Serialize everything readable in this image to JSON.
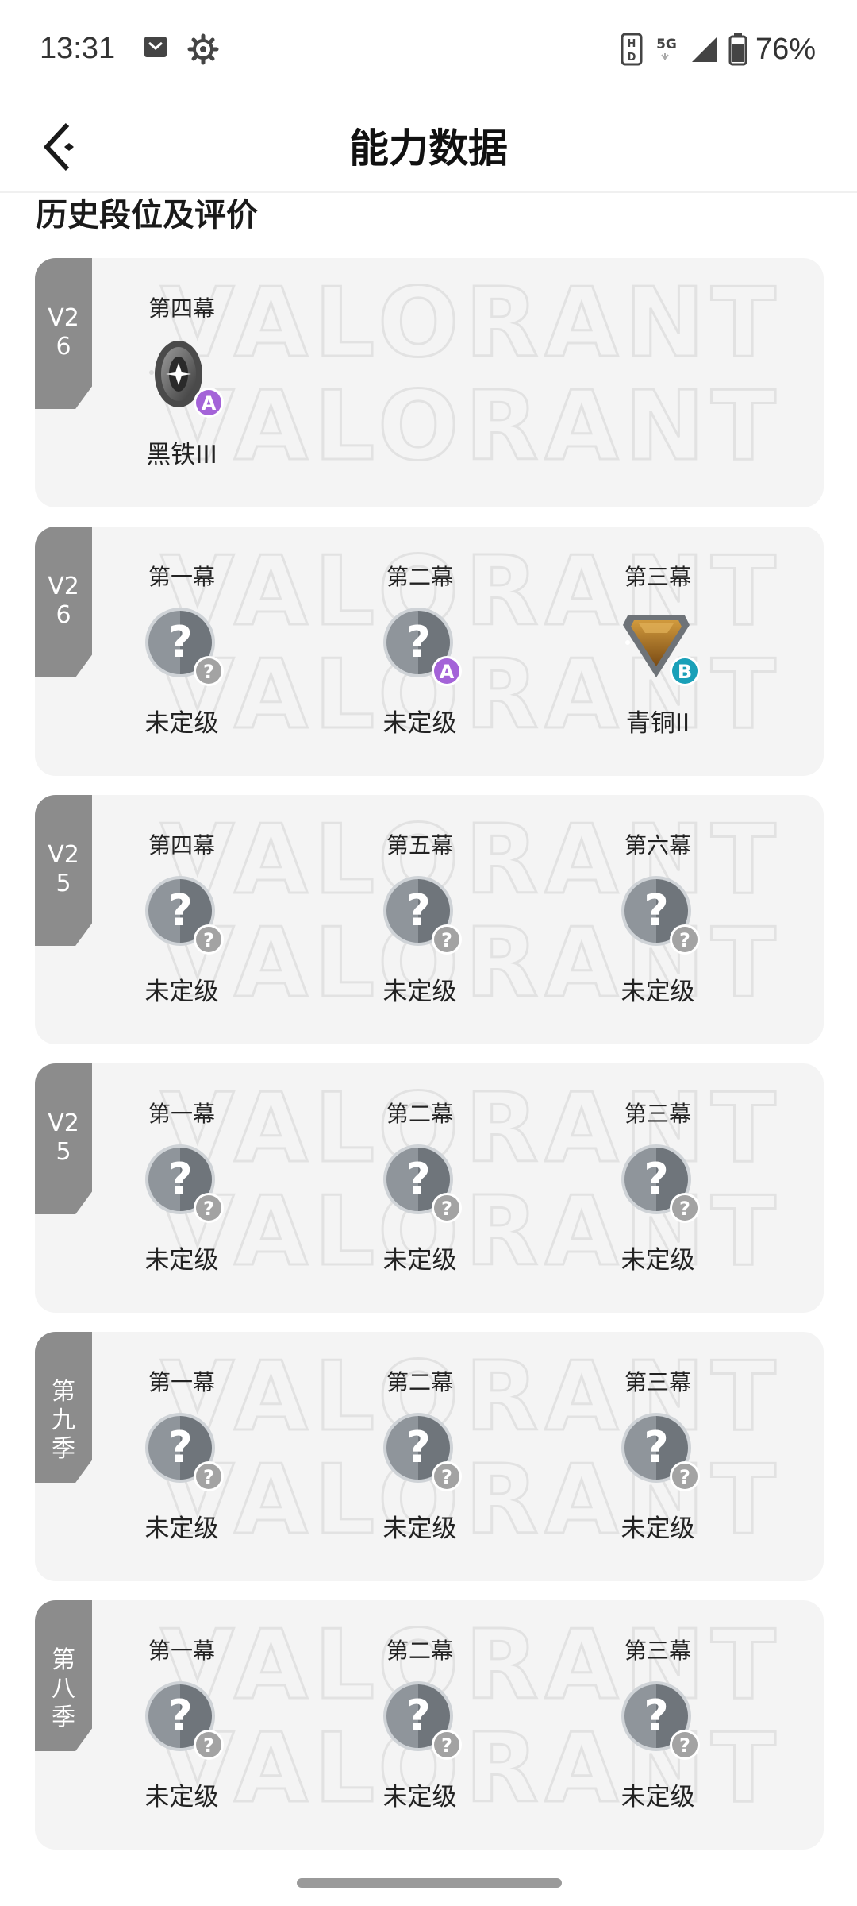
{
  "status_bar": {
    "time": "13:31",
    "network": "5G",
    "battery": "76%"
  },
  "header": {
    "title": "能力数据"
  },
  "section": {
    "title": "历史段位及评价"
  },
  "cards": [
    {
      "season": "V26",
      "acts": [
        {
          "act": "第四幕",
          "rank": "黑铁III",
          "emblem": "iron-emblem-icon",
          "grade": "A"
        }
      ]
    },
    {
      "season": "V26",
      "acts": [
        {
          "act": "第一幕",
          "rank": "未定级",
          "emblem": "unranked-emblem-icon",
          "grade": "?"
        },
        {
          "act": "第二幕",
          "rank": "未定级",
          "emblem": "unranked-emblem-icon",
          "grade": "A"
        },
        {
          "act": "第三幕",
          "rank": "青铜II",
          "emblem": "bronze-emblem-icon",
          "grade": "B"
        }
      ]
    },
    {
      "season": "V25",
      "acts": [
        {
          "act": "第四幕",
          "rank": "未定级",
          "emblem": "unranked-emblem-icon",
          "grade": "?"
        },
        {
          "act": "第五幕",
          "rank": "未定级",
          "emblem": "unranked-emblem-icon",
          "grade": "?"
        },
        {
          "act": "第六幕",
          "rank": "未定级",
          "emblem": "unranked-emblem-icon",
          "grade": "?"
        }
      ]
    },
    {
      "season": "V25",
      "acts": [
        {
          "act": "第一幕",
          "rank": "未定级",
          "emblem": "unranked-emblem-icon",
          "grade": "?"
        },
        {
          "act": "第二幕",
          "rank": "未定级",
          "emblem": "unranked-emblem-icon",
          "grade": "?"
        },
        {
          "act": "第三幕",
          "rank": "未定级",
          "emblem": "unranked-emblem-icon",
          "grade": "?"
        }
      ]
    },
    {
      "season": "第九季",
      "acts": [
        {
          "act": "第一幕",
          "rank": "未定级",
          "emblem": "unranked-emblem-icon",
          "grade": "?"
        },
        {
          "act": "第二幕",
          "rank": "未定级",
          "emblem": "unranked-emblem-icon",
          "grade": "?"
        },
        {
          "act": "第三幕",
          "rank": "未定级",
          "emblem": "unranked-emblem-icon",
          "grade": "?"
        }
      ]
    },
    {
      "season": "第八季",
      "acts": [
        {
          "act": "第一幕",
          "rank": "未定级",
          "emblem": "unranked-emblem-icon",
          "grade": "?"
        },
        {
          "act": "第二幕",
          "rank": "未定级",
          "emblem": "unranked-emblem-icon",
          "grade": "?"
        },
        {
          "act": "第三幕",
          "rank": "未定级",
          "emblem": "unranked-emblem-icon",
          "grade": "?"
        }
      ]
    }
  ],
  "card_watermark": "VALORANT",
  "colors": {
    "season_tag": "#8c8c8c",
    "card_bg": "#f4f4f4",
    "grade_A": "#a463d8",
    "grade_B": "#1aa0b8",
    "grade_unknown": "#a3a3a3"
  }
}
